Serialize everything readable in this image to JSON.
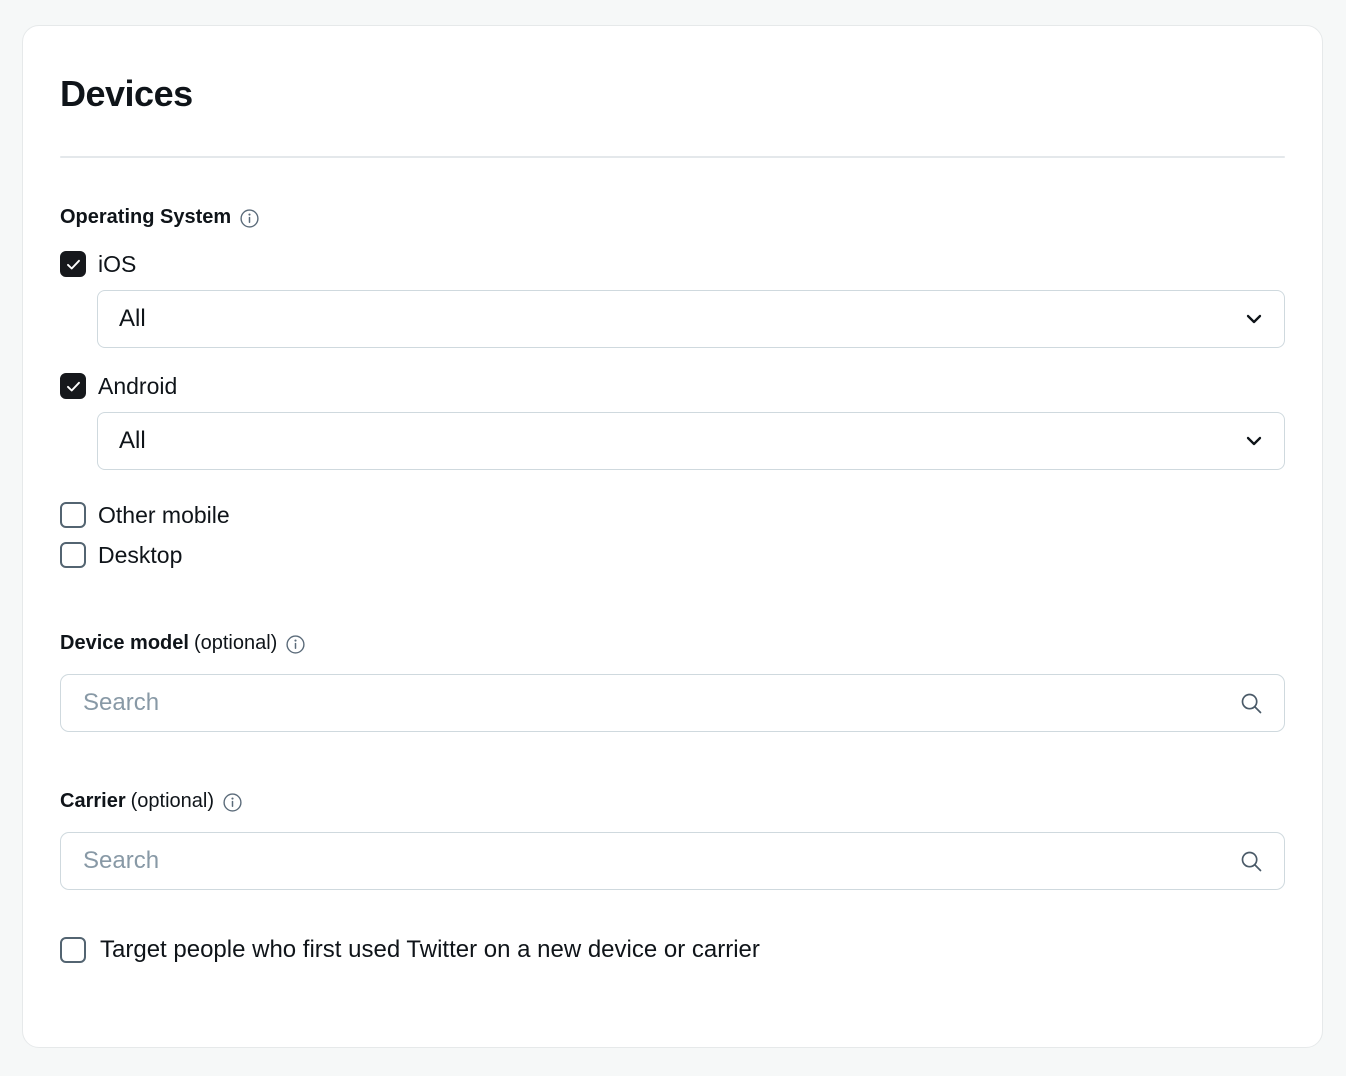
{
  "panel": {
    "title": "Devices"
  },
  "operating_system": {
    "label": "Operating System",
    "info_icon": "info-icon",
    "options": [
      {
        "id": "ios",
        "label": "iOS",
        "checked": true,
        "version_select": {
          "value": "All",
          "icon": "chevron-down-icon"
        }
      },
      {
        "id": "android",
        "label": "Android",
        "checked": true,
        "version_select": {
          "value": "All",
          "icon": "chevron-down-icon"
        }
      },
      {
        "id": "other-mobile",
        "label": "Other mobile",
        "checked": false
      },
      {
        "id": "desktop",
        "label": "Desktop",
        "checked": false
      }
    ]
  },
  "device_model": {
    "label": "Device model",
    "optional_label": "(optional)",
    "info_icon": "info-icon",
    "search": {
      "placeholder": "Search",
      "value": "",
      "icon": "search-icon"
    }
  },
  "carrier": {
    "label": "Carrier",
    "optional_label": "(optional)",
    "info_icon": "info-icon",
    "search": {
      "placeholder": "Search",
      "value": "",
      "icon": "search-icon"
    }
  },
  "new_device_target": {
    "label": "Target people who first used Twitter on a new device or carrier",
    "checked": false
  },
  "colors": {
    "page_background": "#f6f8f8",
    "card_background": "#ffffff",
    "card_border": "#e6e9ea",
    "text_primary": "#0f1419",
    "text_muted": "#8899a6",
    "checkbox_checked": "#16181c",
    "checkbox_border": "#536471",
    "field_border": "#cfd9de",
    "divider": "#e4e8eb"
  }
}
